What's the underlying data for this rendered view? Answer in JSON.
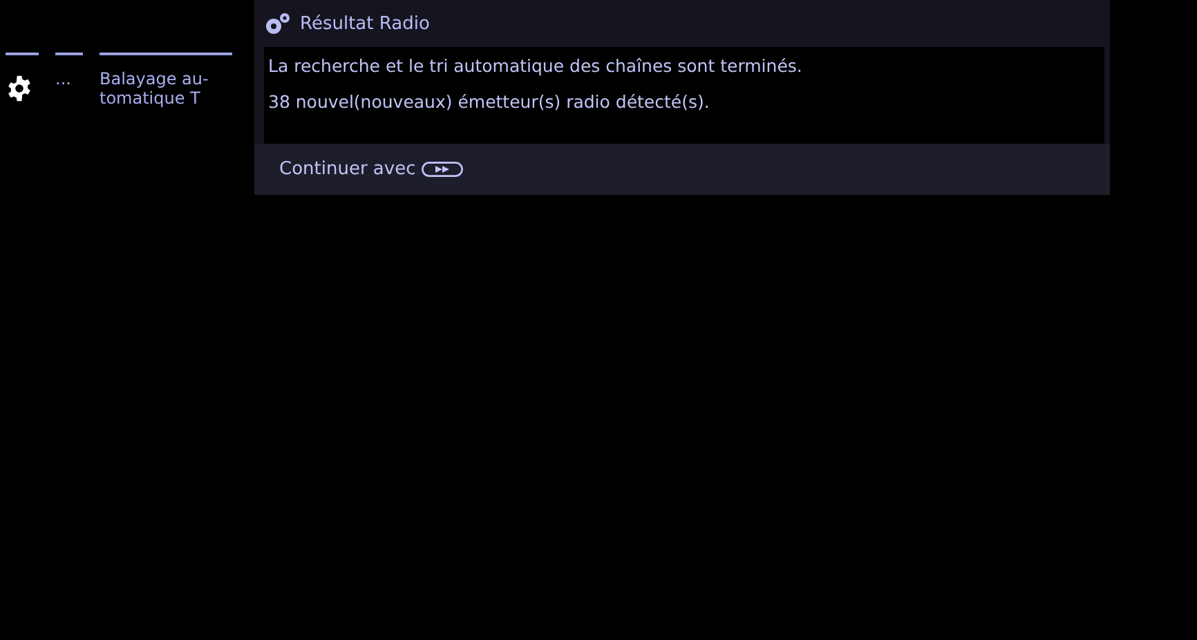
{
  "menu_columns": [
    {
      "kind": "icon"
    },
    {
      "kind": "text",
      "lines": [
        "..."
      ]
    },
    {
      "kind": "text",
      "lines": [
        "Balayage au-",
        "tomatique T"
      ]
    }
  ],
  "dialog": {
    "title": "Résultat Radio",
    "messages": [
      "La recherche et le tri automatique des chaînes sont terminés.",
      "38 nouvel(nouveaux) émetteur(s) radio détecté(s)."
    ],
    "footer": "Continuer avec"
  }
}
